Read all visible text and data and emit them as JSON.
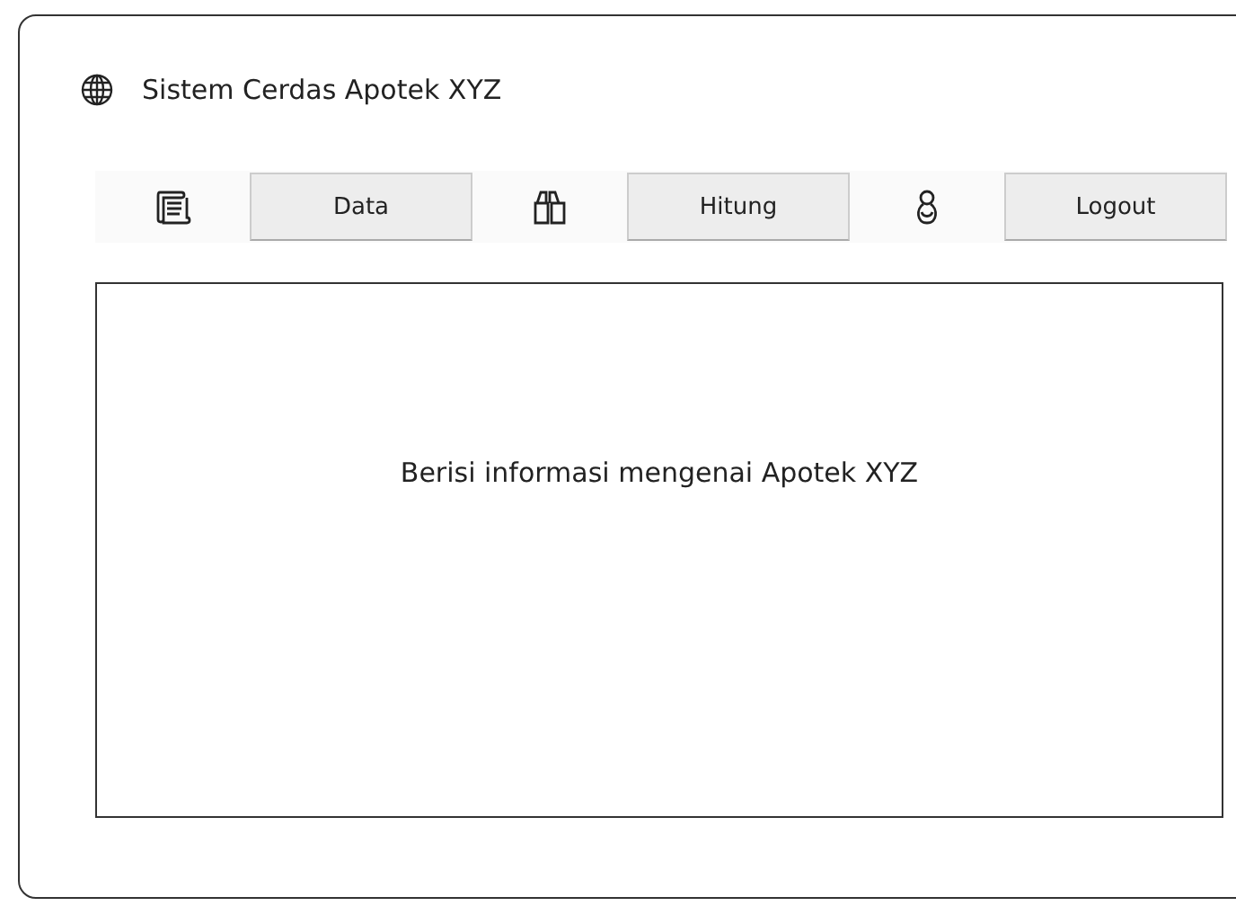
{
  "window": {
    "title": "Sistem Cerdas Apotek XYZ"
  },
  "toolbar": {
    "buttons": [
      {
        "label": "Data"
      },
      {
        "label": "Hitung"
      },
      {
        "label": "Logout"
      }
    ]
  },
  "content": {
    "text": "Berisi informasi mengenai Apotek XYZ"
  }
}
